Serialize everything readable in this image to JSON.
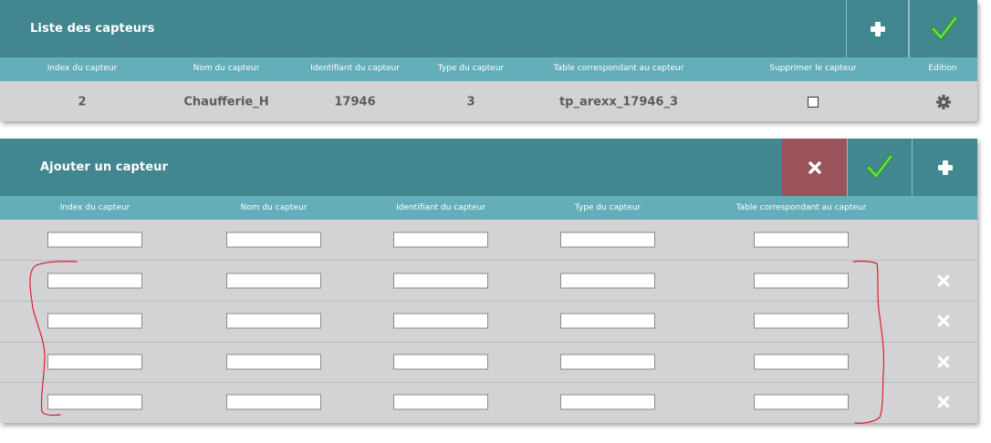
{
  "list_panel": {
    "title": "Liste des capteurs",
    "icons": {
      "add": "plus-icon",
      "validate": "check-icon",
      "edit": "gear-icon"
    },
    "columns": [
      "Index du capteur",
      "Nom du capteur",
      "Identifiant du capteur",
      "Type du capteur",
      "Table correspondant au capteur",
      "Supprimer le capteur",
      "Edition"
    ],
    "rows": [
      {
        "index": "2",
        "name": "Chaufferie_H",
        "identifier": "17946",
        "type": "3",
        "table": "tp_arexx_17946_3",
        "delete_checked": false
      }
    ]
  },
  "add_panel": {
    "title": "Ajouter un capteur",
    "icons": {
      "cancel": "x-icon",
      "validate": "check-icon",
      "add": "plus-icon",
      "remove_row": "x-icon"
    },
    "columns": [
      "Index du capteur",
      "Nom du capteur",
      "Identifiant du capteur",
      "Type du capteur",
      "Table correspondant au capteur"
    ],
    "input_rows": 5,
    "input_values": [
      "",
      "",
      "",
      "",
      ""
    ]
  },
  "colors": {
    "title_bar": "#42868f",
    "header_bar": "#64aeb9",
    "body": "#d3d3d6",
    "cancel_button": "#9a5358",
    "check_green": "#3fbf2e",
    "annotation_red": "#d8202a"
  }
}
